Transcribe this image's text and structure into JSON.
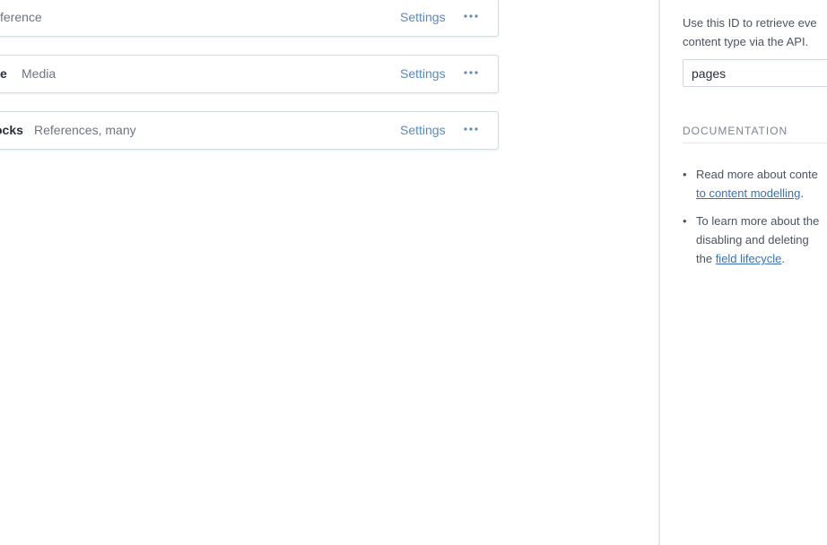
{
  "fields": [
    {
      "name": "",
      "type": "ference",
      "settings_label": "Settings",
      "more_icon": "more-horizontal-icon"
    },
    {
      "name": "e",
      "type": "Media",
      "settings_label": "Settings",
      "more_icon": "more-horizontal-icon"
    },
    {
      "name": "ocks",
      "type": "References, many",
      "settings_label": "Settings",
      "more_icon": "more-horizontal-icon"
    }
  ],
  "sidebar": {
    "api_help_line1": "Use this ID to retrieve eve",
    "api_help_line2": "content type via the API.",
    "api_id_value": "pages",
    "documentation": {
      "title": "DOCUMENTATION",
      "item1": {
        "line1": "Read more about conte",
        "link": "to content modelling",
        "after": "."
      },
      "item2": {
        "line1": "To learn more about the",
        "line2": "disabling and deleting",
        "line3_before": "the ",
        "link": "field lifecycle",
        "after": "."
      }
    }
  },
  "colors": {
    "link": "#5b8ac0",
    "border": "#d3dce0",
    "text": "#2a3039",
    "muted": "#6b7583"
  }
}
